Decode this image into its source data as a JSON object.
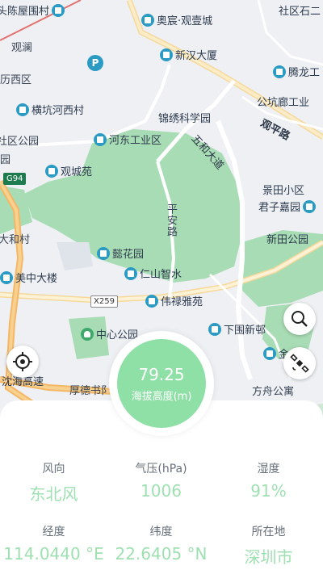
{
  "map": {
    "pois": [
      {
        "id": "chenwu",
        "label": "头陈屋围村",
        "kind": "building"
      },
      {
        "id": "aochen",
        "label": "奥宸·观壹城",
        "kind": "building"
      },
      {
        "id": "shequ",
        "label": "社区石二",
        "kind": "building"
      },
      {
        "id": "guanlan",
        "label": "观澜",
        "kind": "district"
      },
      {
        "id": "xinhan",
        "label": "新汉大厦",
        "kind": "building"
      },
      {
        "id": "tenglong",
        "label": "腾龙工",
        "kind": "building"
      },
      {
        "id": "lishi",
        "label": "历西区",
        "kind": "district"
      },
      {
        "id": "gongkang",
        "label": "公坑廊工业",
        "kind": "building"
      },
      {
        "id": "hengkeng",
        "label": "横坑河西村",
        "kind": "building"
      },
      {
        "id": "jinxiu",
        "label": "锦绣科学园",
        "kind": "building"
      },
      {
        "id": "shequ2",
        "label": "社区公园",
        "kind": "district"
      },
      {
        "id": "hedong",
        "label": "河东工业区",
        "kind": "building"
      },
      {
        "id": "yuan",
        "label": "园",
        "kind": "district"
      },
      {
        "id": "guancheng",
        "label": "观城苑",
        "kind": "building"
      },
      {
        "id": "jingtian",
        "label": "景田小区",
        "kind": "building"
      },
      {
        "id": "junzi",
        "label": "君子嘉园",
        "kind": "building"
      },
      {
        "id": "dahe",
        "label": "大和村",
        "kind": "district"
      },
      {
        "id": "xintian",
        "label": "新田公园",
        "kind": "park"
      },
      {
        "id": "yihua",
        "label": "懿花园",
        "kind": "building"
      },
      {
        "id": "renshan",
        "label": "仁山智水",
        "kind": "building"
      },
      {
        "id": "meizhong",
        "label": "美中大楼",
        "kind": "building"
      },
      {
        "id": "weilu",
        "label": "伟禄雅苑",
        "kind": "building"
      },
      {
        "id": "zhongxin",
        "label": "中心公园",
        "kind": "park"
      },
      {
        "id": "xiawei",
        "label": "下围新邨",
        "kind": "building"
      },
      {
        "id": "jinhe",
        "label": "金禾",
        "kind": "building"
      },
      {
        "id": "houde",
        "label": "厚德书阝",
        "kind": "district"
      },
      {
        "id": "fangzhou",
        "label": "方舟公寓",
        "kind": "district"
      }
    ],
    "roads": {
      "guanping": "观平路",
      "wuhe": "五和大道",
      "pingan": "平安路",
      "yanhai": "沈海高速"
    },
    "shields": {
      "g94": "G94",
      "x259": "X259"
    },
    "parking": "P",
    "icons": {
      "locate": "locate-crosshair-icon",
      "search": "search-icon",
      "satellite": "satellite-icon"
    }
  },
  "altitude": {
    "value": "79.25",
    "label": "海拔高度(m)"
  },
  "stats": {
    "wind": {
      "label": "风向",
      "value": "东北风"
    },
    "pressure": {
      "label": "气压(hPa)",
      "value": "1006"
    },
    "humidity": {
      "label": "湿度",
      "value": "91%"
    },
    "longitude": {
      "label": "经度",
      "value": "114.0440 °E"
    },
    "latitude": {
      "label": "纬度",
      "value": "22.6405 °N"
    },
    "location": {
      "label": "所在地",
      "value": "深圳市"
    }
  },
  "colors": {
    "accent": "#8fe0a6",
    "stat_value": "#9fe0b2",
    "map_green": "#a8dcb4",
    "poi_blue": "#2b9bc4"
  }
}
